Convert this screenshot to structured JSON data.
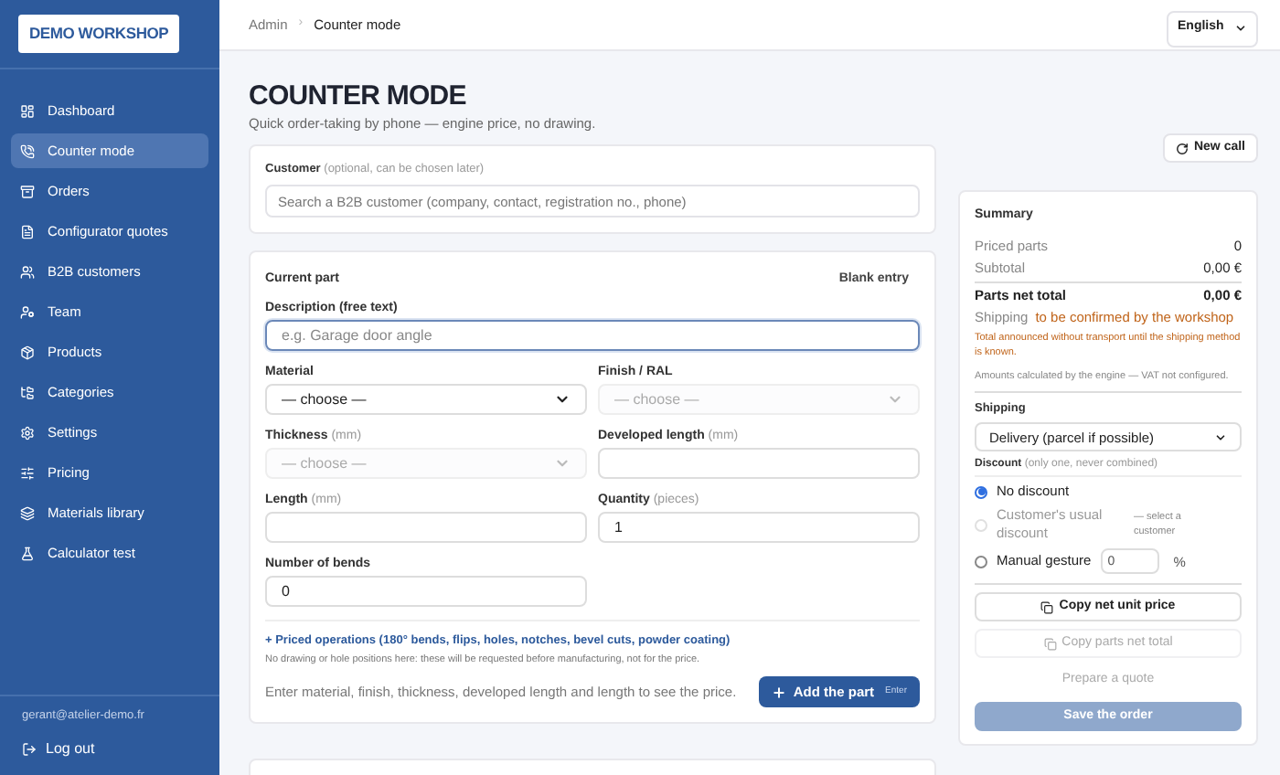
{
  "sidebar": {
    "brand": "DEMO WORKSHOP",
    "items": [
      {
        "label": "Dashboard",
        "selected": false
      },
      {
        "label": "Counter mode",
        "selected": true
      },
      {
        "label": "Orders",
        "selected": false
      },
      {
        "label": "Configurator quotes",
        "selected": false
      },
      {
        "label": "B2B customers",
        "selected": false
      },
      {
        "label": "Team",
        "selected": false
      },
      {
        "label": "Products",
        "selected": false
      },
      {
        "label": "Categories",
        "selected": false
      },
      {
        "label": "Settings",
        "selected": false
      },
      {
        "label": "Pricing",
        "selected": false
      },
      {
        "label": "Materials library",
        "selected": false
      },
      {
        "label": "Calculator test",
        "selected": false
      }
    ],
    "user_email": "gerant@atelier-demo.fr",
    "logout": "Log out"
  },
  "header": {
    "breadcrumb": [
      "Admin",
      "Counter mode"
    ],
    "separator": "›",
    "language": "English"
  },
  "page": {
    "title": "COUNTER MODE",
    "subtitle": "Quick order-taking by phone — engine price, no drawing.",
    "new_call": "New call"
  },
  "customer": {
    "label": "Customer",
    "hint": "(optional, can be chosen later)",
    "placeholder": "Search a B2B customer (company, contact, registration no., phone)"
  },
  "current_part": {
    "title": "Current part",
    "mode": "Blank entry",
    "fields": [
      {
        "kind": "wide_input",
        "label": "Description (free text)",
        "placeholder": "e.g. Garage door angle",
        "focused": true
      },
      {
        "kind": "select",
        "label": "Material",
        "value": "— choose —",
        "disabled": false
      },
      {
        "kind": "select",
        "label": "Finish / RAL",
        "value": "— choose —",
        "disabled": true
      },
      {
        "kind": "select",
        "label": "Thickness",
        "unit": "(mm)",
        "value": "— choose —",
        "disabled": true
      },
      {
        "kind": "input",
        "label": "Developed length",
        "unit": "(mm)"
      },
      {
        "kind": "input",
        "label": "Length",
        "unit": "(mm)"
      },
      {
        "kind": "input",
        "label": "Quantity",
        "unit": "(pieces)",
        "value": "1"
      },
      {
        "kind": "input",
        "label": "Number of bends",
        "value": "0"
      }
    ],
    "operations_link": "+ Priced operations (180° bends, flips, holes, notches, bevel cuts, powder coating)",
    "operations_note": "No drawing or hole positions here: these will be requested before manufacturing, not for the price.",
    "price_hint": "Enter material, finish, thickness, developed length and length to see the price.",
    "add_button": "Add the part",
    "add_shortcut": "Enter"
  },
  "summary": {
    "title": "Summary",
    "rows": [
      {
        "kind": "plain",
        "label": "Priced parts",
        "value": "0"
      },
      {
        "kind": "plain",
        "label": "Subtotal",
        "value": "0,00 €"
      },
      {
        "kind": "total",
        "label": "Parts net total",
        "value": "0,00 €"
      }
    ],
    "shipping_label": "Shipping",
    "shipping_value": "to be confirmed by the workshop",
    "shipping_warning": "Total announced without transport until the shipping method is known.",
    "engine_note": "Amounts calculated by the engine — VAT not configured.",
    "shipping_select_label": "Shipping",
    "shipping_select_value": "Delivery (parcel if possible)",
    "discount_label": "Discount",
    "discount_hint": "(only one, never combined)",
    "discount_options": [
      {
        "kind": "plain",
        "label": "No discount",
        "selected": true,
        "disabled": false
      },
      {
        "kind": "note",
        "label": "Customer's usual discount",
        "note": "— select a customer",
        "selected": false,
        "disabled": true
      },
      {
        "kind": "percent",
        "label": "Manual gesture",
        "value": "0",
        "unit": "%",
        "selected": false,
        "disabled": false
      }
    ],
    "buttons": [
      {
        "kind": "copy",
        "label": "Copy net unit price",
        "disabled": false
      },
      {
        "kind": "copy",
        "label": "Copy parts net total",
        "disabled": true
      },
      {
        "kind": "text",
        "label": "Prepare a quote",
        "disabled": true
      },
      {
        "kind": "primary",
        "label": "Save the order",
        "disabled": true
      }
    ]
  }
}
